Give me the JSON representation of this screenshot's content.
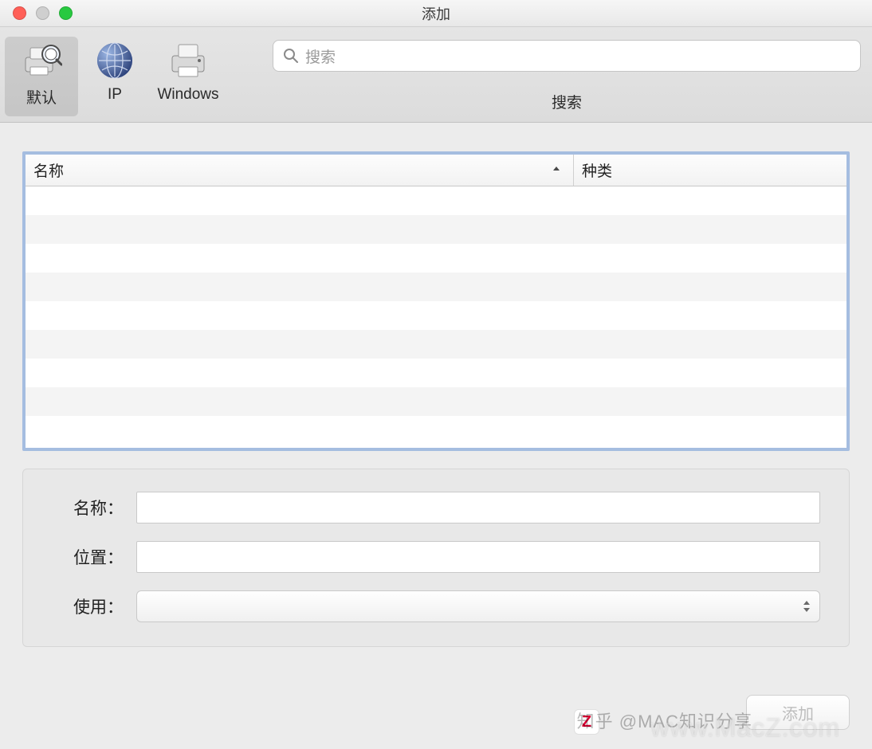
{
  "window": {
    "title": "添加"
  },
  "toolbar": {
    "items": [
      {
        "label": "默认",
        "icon": "printer-magnifier-icon",
        "active": true
      },
      {
        "label": "IP",
        "icon": "globe-network-icon",
        "active": false
      },
      {
        "label": "Windows",
        "icon": "printer-icon",
        "active": false
      }
    ],
    "search": {
      "placeholder": "搜索",
      "label": "搜索"
    }
  },
  "list": {
    "columns": {
      "name": "名称",
      "kind": "种类"
    },
    "sort": {
      "column": "name",
      "direction": "asc"
    },
    "rows": []
  },
  "form": {
    "name": {
      "label": "名称：",
      "value": ""
    },
    "location": {
      "label": "位置：",
      "value": ""
    },
    "use": {
      "label": "使用：",
      "value": ""
    }
  },
  "footer": {
    "add_button": "添加",
    "enabled": false
  },
  "watermarks": {
    "w1": "知乎 @MAC知识分享",
    "w2": "www.MacZ.com",
    "badge": "Z"
  }
}
